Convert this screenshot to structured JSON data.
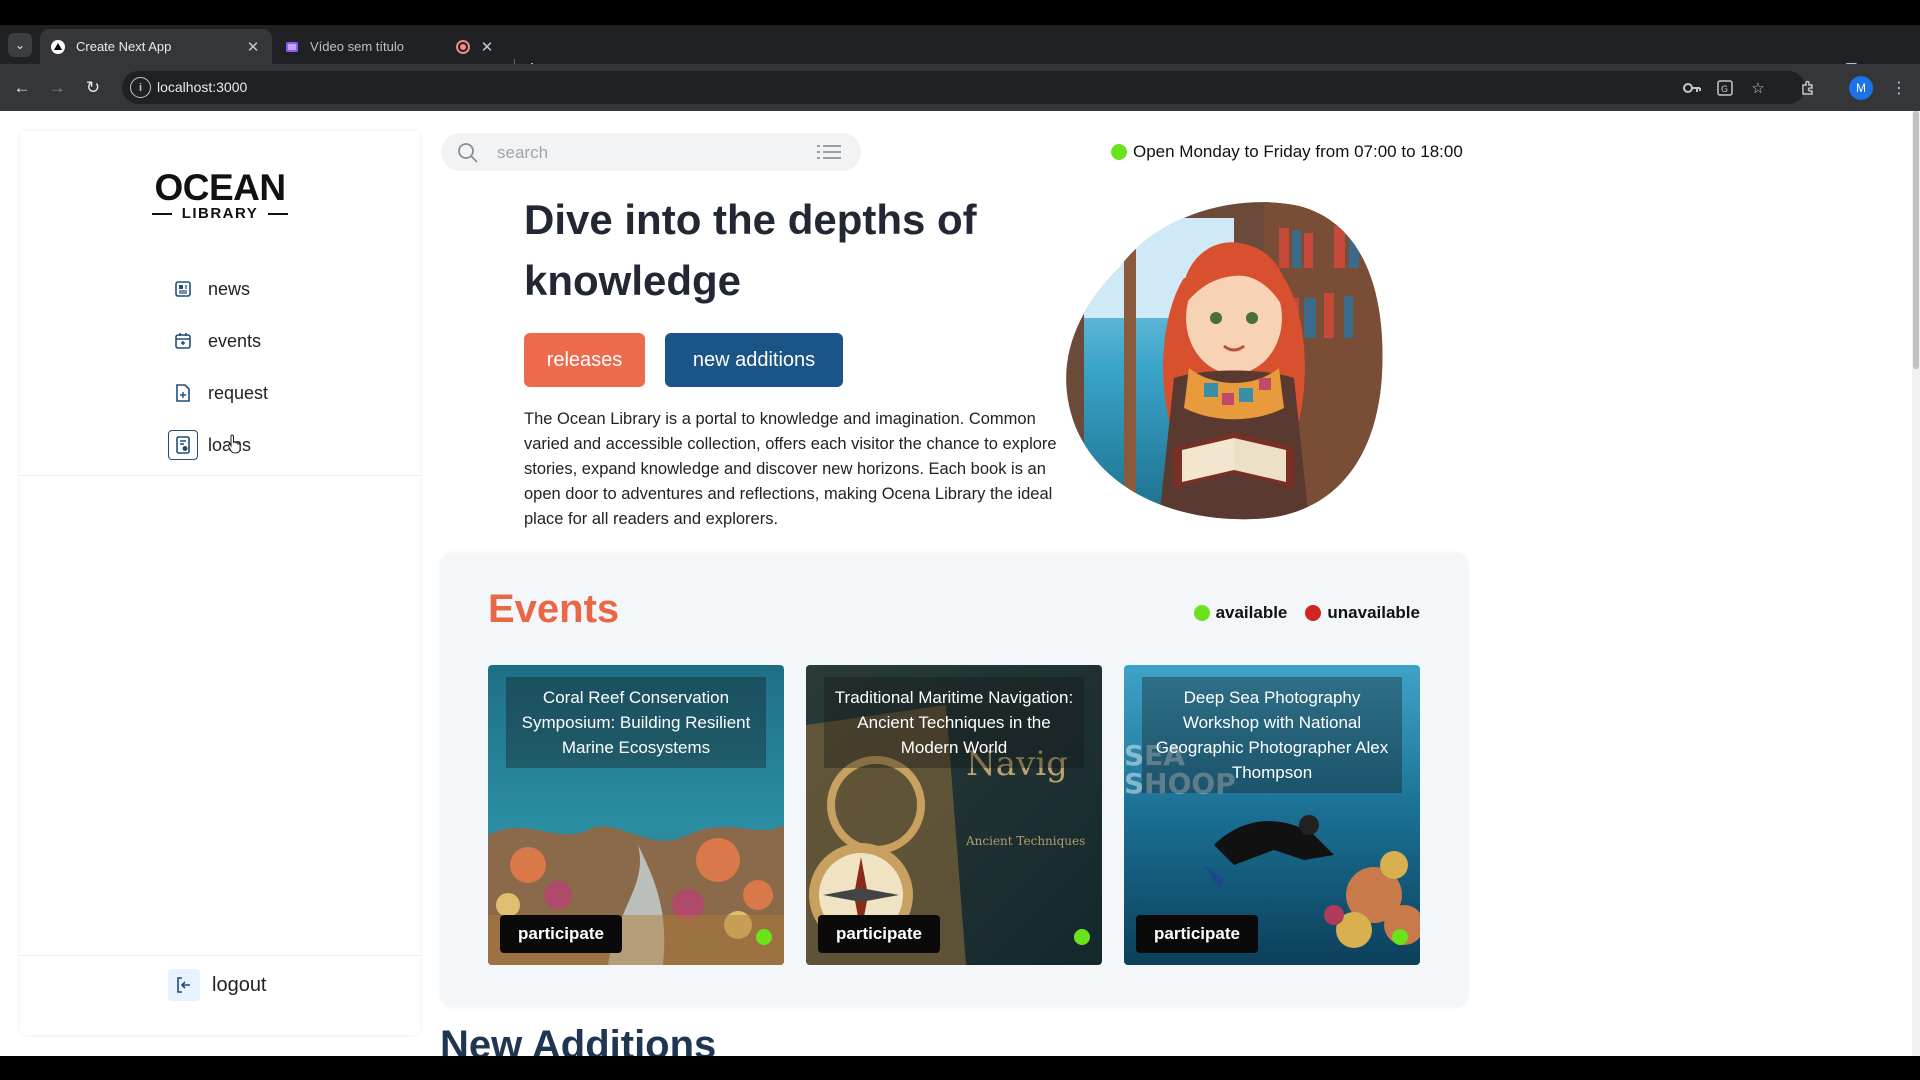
{
  "browser": {
    "tabs": [
      {
        "title": "Create Next App",
        "active": true
      },
      {
        "title": "Vídeo sem título",
        "active": false,
        "recording": true
      }
    ],
    "url": "localhost:3000",
    "profile_initial": "M"
  },
  "sidebar": {
    "logo_main": "OCEAN",
    "logo_sub": "LIBRARY",
    "items": [
      {
        "label": "news",
        "icon": "newspaper-icon"
      },
      {
        "label": "events",
        "icon": "calendar-icon"
      },
      {
        "label": "request",
        "icon": "document-icon"
      },
      {
        "label": "loans",
        "icon": "book-loan-icon",
        "active": true
      }
    ],
    "logout_label": "logout"
  },
  "header": {
    "search_placeholder": "search",
    "open_hours": "Open Monday to Friday from 07:00 to 18:00"
  },
  "hero": {
    "title": "Dive into the depths of knowledge",
    "releases_label": "releases",
    "new_additions_label": "new additions",
    "description": "The Ocean Library is a portal to knowledge and imagination. Common varied and accessible collection, offers each visitor the chance to explore stories, expand knowledge and discover new horizons. Each book is an open door to adventures and reflections, making Ocena Library the ideal place for all readers and explorers."
  },
  "events": {
    "title": "Events",
    "legend_available": "available",
    "legend_unavailable": "unavailable",
    "cards": [
      {
        "title": "Coral Reef Conservation Symposium: Building Resilient Marine Ecosystems",
        "button": "participate",
        "status": "available"
      },
      {
        "title": "Traditional Maritime Navigation: Ancient Techniques in the Modern World",
        "button": "participate",
        "status": "available"
      },
      {
        "title": "Deep Sea Photography Workshop with National Geographic Photographer Alex Thompson",
        "button": "participate",
        "status": "available"
      }
    ]
  },
  "new_additions_title": "New Additions",
  "colors": {
    "accent_orange": "#ee6a4c",
    "accent_blue": "#1b5487",
    "available": "#6be31a",
    "unavailable": "#d0261f"
  }
}
